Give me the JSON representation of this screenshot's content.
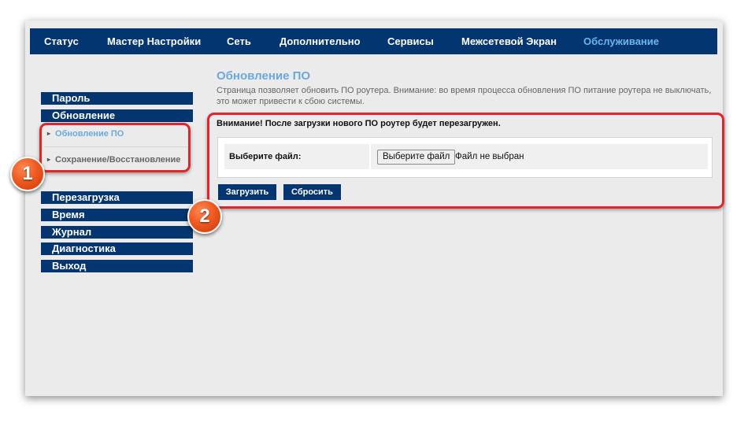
{
  "topnav": {
    "items": [
      {
        "label": "Статус"
      },
      {
        "label": "Мастер Настройки"
      },
      {
        "label": "Сеть"
      },
      {
        "label": "Дополнительно"
      },
      {
        "label": "Сервисы"
      },
      {
        "label": "Межсетевой Экран"
      },
      {
        "label": "Обслуживание",
        "active": true
      }
    ],
    "active_color": "#6bb6f0",
    "bg_color": "#033570"
  },
  "sidebar": {
    "items_top": [
      {
        "label": "Пароль"
      },
      {
        "label": "Обновление"
      }
    ],
    "subitems": [
      {
        "label": "Обновление ПО",
        "active": true
      },
      {
        "label": "Сохранение/Восстановление",
        "active": false
      }
    ],
    "items_bottom": [
      {
        "label": "Перезагрузка"
      },
      {
        "label": "Время"
      },
      {
        "label": "Журнал"
      },
      {
        "label": "Диагностика"
      },
      {
        "label": "Выход"
      }
    ]
  },
  "main": {
    "title": "Обновление ПО",
    "description": "Страница позволяет обновить ПО роутера. Внимание: во время процесса обновления ПО питание роутера не выключать, это может привести к сбою системы.",
    "warning": "Внимание! После загрузки нового ПО роутер будет перезагружен.",
    "file_label": "Выберите файл:",
    "file_button": "Выберите файл",
    "file_status": "Файл не выбран",
    "upload_button": "Загрузить",
    "reset_button": "Сбросить"
  },
  "annotations": {
    "badge_1": "1",
    "badge_2": "2",
    "highlight_color": "#e0252b",
    "badge_color": "#ef5a20"
  }
}
